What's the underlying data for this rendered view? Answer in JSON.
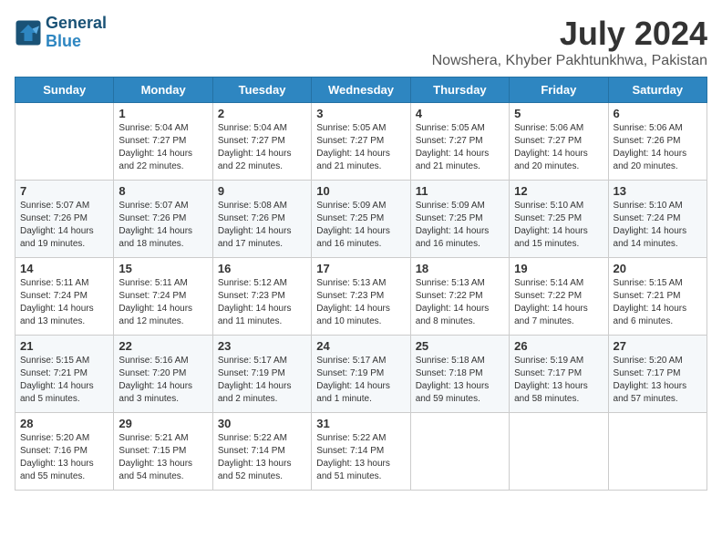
{
  "header": {
    "logo_line1": "General",
    "logo_line2": "Blue",
    "month": "July 2024",
    "location": "Nowshera, Khyber Pakhtunkhwa, Pakistan"
  },
  "days_of_week": [
    "Sunday",
    "Monday",
    "Tuesday",
    "Wednesday",
    "Thursday",
    "Friday",
    "Saturday"
  ],
  "weeks": [
    [
      {
        "day": "",
        "sunrise": "",
        "sunset": "",
        "daylight": ""
      },
      {
        "day": "1",
        "sunrise": "Sunrise: 5:04 AM",
        "sunset": "Sunset: 7:27 PM",
        "daylight": "Daylight: 14 hours and 22 minutes."
      },
      {
        "day": "2",
        "sunrise": "Sunrise: 5:04 AM",
        "sunset": "Sunset: 7:27 PM",
        "daylight": "Daylight: 14 hours and 22 minutes."
      },
      {
        "day": "3",
        "sunrise": "Sunrise: 5:05 AM",
        "sunset": "Sunset: 7:27 PM",
        "daylight": "Daylight: 14 hours and 21 minutes."
      },
      {
        "day": "4",
        "sunrise": "Sunrise: 5:05 AM",
        "sunset": "Sunset: 7:27 PM",
        "daylight": "Daylight: 14 hours and 21 minutes."
      },
      {
        "day": "5",
        "sunrise": "Sunrise: 5:06 AM",
        "sunset": "Sunset: 7:27 PM",
        "daylight": "Daylight: 14 hours and 20 minutes."
      },
      {
        "day": "6",
        "sunrise": "Sunrise: 5:06 AM",
        "sunset": "Sunset: 7:26 PM",
        "daylight": "Daylight: 14 hours and 20 minutes."
      }
    ],
    [
      {
        "day": "7",
        "sunrise": "Sunrise: 5:07 AM",
        "sunset": "Sunset: 7:26 PM",
        "daylight": "Daylight: 14 hours and 19 minutes."
      },
      {
        "day": "8",
        "sunrise": "Sunrise: 5:07 AM",
        "sunset": "Sunset: 7:26 PM",
        "daylight": "Daylight: 14 hours and 18 minutes."
      },
      {
        "day": "9",
        "sunrise": "Sunrise: 5:08 AM",
        "sunset": "Sunset: 7:26 PM",
        "daylight": "Daylight: 14 hours and 17 minutes."
      },
      {
        "day": "10",
        "sunrise": "Sunrise: 5:09 AM",
        "sunset": "Sunset: 7:25 PM",
        "daylight": "Daylight: 14 hours and 16 minutes."
      },
      {
        "day": "11",
        "sunrise": "Sunrise: 5:09 AM",
        "sunset": "Sunset: 7:25 PM",
        "daylight": "Daylight: 14 hours and 16 minutes."
      },
      {
        "day": "12",
        "sunrise": "Sunrise: 5:10 AM",
        "sunset": "Sunset: 7:25 PM",
        "daylight": "Daylight: 14 hours and 15 minutes."
      },
      {
        "day": "13",
        "sunrise": "Sunrise: 5:10 AM",
        "sunset": "Sunset: 7:24 PM",
        "daylight": "Daylight: 14 hours and 14 minutes."
      }
    ],
    [
      {
        "day": "14",
        "sunrise": "Sunrise: 5:11 AM",
        "sunset": "Sunset: 7:24 PM",
        "daylight": "Daylight: 14 hours and 13 minutes."
      },
      {
        "day": "15",
        "sunrise": "Sunrise: 5:11 AM",
        "sunset": "Sunset: 7:24 PM",
        "daylight": "Daylight: 14 hours and 12 minutes."
      },
      {
        "day": "16",
        "sunrise": "Sunrise: 5:12 AM",
        "sunset": "Sunset: 7:23 PM",
        "daylight": "Daylight: 14 hours and 11 minutes."
      },
      {
        "day": "17",
        "sunrise": "Sunrise: 5:13 AM",
        "sunset": "Sunset: 7:23 PM",
        "daylight": "Daylight: 14 hours and 10 minutes."
      },
      {
        "day": "18",
        "sunrise": "Sunrise: 5:13 AM",
        "sunset": "Sunset: 7:22 PM",
        "daylight": "Daylight: 14 hours and 8 minutes."
      },
      {
        "day": "19",
        "sunrise": "Sunrise: 5:14 AM",
        "sunset": "Sunset: 7:22 PM",
        "daylight": "Daylight: 14 hours and 7 minutes."
      },
      {
        "day": "20",
        "sunrise": "Sunrise: 5:15 AM",
        "sunset": "Sunset: 7:21 PM",
        "daylight": "Daylight: 14 hours and 6 minutes."
      }
    ],
    [
      {
        "day": "21",
        "sunrise": "Sunrise: 5:15 AM",
        "sunset": "Sunset: 7:21 PM",
        "daylight": "Daylight: 14 hours and 5 minutes."
      },
      {
        "day": "22",
        "sunrise": "Sunrise: 5:16 AM",
        "sunset": "Sunset: 7:20 PM",
        "daylight": "Daylight: 14 hours and 3 minutes."
      },
      {
        "day": "23",
        "sunrise": "Sunrise: 5:17 AM",
        "sunset": "Sunset: 7:19 PM",
        "daylight": "Daylight: 14 hours and 2 minutes."
      },
      {
        "day": "24",
        "sunrise": "Sunrise: 5:17 AM",
        "sunset": "Sunset: 7:19 PM",
        "daylight": "Daylight: 14 hours and 1 minute."
      },
      {
        "day": "25",
        "sunrise": "Sunrise: 5:18 AM",
        "sunset": "Sunset: 7:18 PM",
        "daylight": "Daylight: 13 hours and 59 minutes."
      },
      {
        "day": "26",
        "sunrise": "Sunrise: 5:19 AM",
        "sunset": "Sunset: 7:17 PM",
        "daylight": "Daylight: 13 hours and 58 minutes."
      },
      {
        "day": "27",
        "sunrise": "Sunrise: 5:20 AM",
        "sunset": "Sunset: 7:17 PM",
        "daylight": "Daylight: 13 hours and 57 minutes."
      }
    ],
    [
      {
        "day": "28",
        "sunrise": "Sunrise: 5:20 AM",
        "sunset": "Sunset: 7:16 PM",
        "daylight": "Daylight: 13 hours and 55 minutes."
      },
      {
        "day": "29",
        "sunrise": "Sunrise: 5:21 AM",
        "sunset": "Sunset: 7:15 PM",
        "daylight": "Daylight: 13 hours and 54 minutes."
      },
      {
        "day": "30",
        "sunrise": "Sunrise: 5:22 AM",
        "sunset": "Sunset: 7:14 PM",
        "daylight": "Daylight: 13 hours and 52 minutes."
      },
      {
        "day": "31",
        "sunrise": "Sunrise: 5:22 AM",
        "sunset": "Sunset: 7:14 PM",
        "daylight": "Daylight: 13 hours and 51 minutes."
      },
      {
        "day": "",
        "sunrise": "",
        "sunset": "",
        "daylight": ""
      },
      {
        "day": "",
        "sunrise": "",
        "sunset": "",
        "daylight": ""
      },
      {
        "day": "",
        "sunrise": "",
        "sunset": "",
        "daylight": ""
      }
    ]
  ]
}
